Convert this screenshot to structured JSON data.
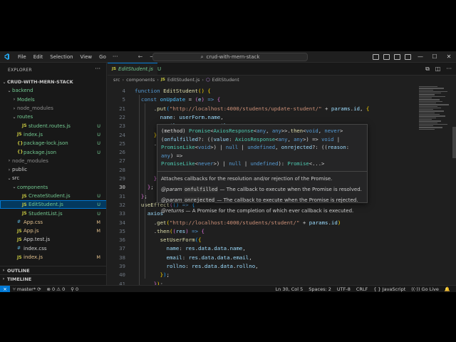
{
  "titlebar": {
    "menu": [
      "File",
      "Edit",
      "Selection",
      "View",
      "Go"
    ],
    "more": "···",
    "back": "←",
    "forward": "→",
    "search_text": "crud-with-mern-stack",
    "minimize": "—",
    "maximize": "☐",
    "close": "✕"
  },
  "sidebar": {
    "title": "EXPLORER",
    "more": "···",
    "tree": [
      {
        "label": "CRUD-WITH-MERN-STACK",
        "indent": 0,
        "chev": "⌄",
        "kind": "root"
      },
      {
        "label": "backend",
        "indent": 1,
        "chev": "⌄",
        "kind": "folder",
        "color": "green"
      },
      {
        "label": "Models",
        "indent": 2,
        "chev": "›",
        "kind": "folder",
        "color": "green"
      },
      {
        "label": "node_modules",
        "indent": 2,
        "chev": "›",
        "kind": "folder",
        "color": "grey"
      },
      {
        "label": "routes",
        "indent": 2,
        "chev": "⌄",
        "kind": "folder",
        "color": "green"
      },
      {
        "label": "student.routes.js",
        "indent": 3,
        "kind": "js",
        "color": "green",
        "badge": "U"
      },
      {
        "label": "index.js",
        "indent": 2,
        "kind": "js",
        "color": "green",
        "badge": "U"
      },
      {
        "label": "package-lock.json",
        "indent": 2,
        "kind": "json",
        "color": "green",
        "badge": "U"
      },
      {
        "label": "package.json",
        "indent": 2,
        "kind": "json",
        "color": "green",
        "badge": "U"
      },
      {
        "label": "node_modules",
        "indent": 1,
        "chev": "›",
        "kind": "folder",
        "color": "grey"
      },
      {
        "label": "public",
        "indent": 1,
        "chev": "›",
        "kind": "folder"
      },
      {
        "label": "src",
        "indent": 1,
        "chev": "⌄",
        "kind": "folder"
      },
      {
        "label": "components",
        "indent": 2,
        "chev": "⌄",
        "kind": "folder",
        "color": "green"
      },
      {
        "label": "CreateStudent.js",
        "indent": 3,
        "kind": "js",
        "color": "green",
        "badge": "U"
      },
      {
        "label": "EditStudent.js",
        "indent": 3,
        "kind": "js",
        "color": "green",
        "badge": "U",
        "selected": true
      },
      {
        "label": "StudentList.js",
        "indent": 3,
        "kind": "js",
        "color": "green",
        "badge": "U"
      },
      {
        "label": "App.css",
        "indent": 2,
        "kind": "css",
        "color": "orange",
        "badge": "M"
      },
      {
        "label": "App.js",
        "indent": 2,
        "kind": "js",
        "color": "orange",
        "badge": "M"
      },
      {
        "label": "App.test.js",
        "indent": 2,
        "kind": "js"
      },
      {
        "label": "index.css",
        "indent": 2,
        "kind": "css"
      },
      {
        "label": "index.js",
        "indent": 2,
        "kind": "js",
        "color": "orange",
        "badge": "M"
      }
    ],
    "outline": "OUTLINE",
    "timeline": "TIMELINE"
  },
  "editor": {
    "tab": {
      "icon": "JS",
      "name": "EditStudent.js",
      "status": "U"
    },
    "breadcrumb": [
      "src",
      "components",
      "EditStudent.js",
      "EditStudent"
    ],
    "lines": [
      {
        "n": "4",
        "html": "<span class='k'>function</span> <span class='f'>EditStudent</span><span class='bk1'>()</span> <span class='bk1'>{</span>"
      },
      {
        "n": "5",
        "html": "  <span class='k'>const</span> <span class='vc'>onUpdate</span> <span class='p'>=</span> <span class='bk2'>(</span><span class='v'>e</span><span class='bk2'>)</span> <span class='k'>=&gt;</span> <span class='bk2'>{</span>"
      },
      {
        "n": "21",
        "html": "      <span class='p'>.</span><span class='f'>put</span><span class='bk3'>(</span><span class='s'>\"http://localhost:4000/students/update-student/\"</span> <span class='p'>+</span> <span class='v'>params</span><span class='p'>.</span><span class='v'>id</span><span class='p'>,</span> <span class='bk1'>{</span>"
      },
      {
        "n": "22",
        "html": "        <span class='v'>name</span><span class='p'>:</span> <span class='v'>userForm</span><span class='p'>.</span><span class='v'>name</span><span class='p'>,</span>"
      },
      {
        "n": "23",
        "html": "        <span class='v'>email</span><span class='p'>:</span> <span class='v'>userForm</span><span class='p'>.</span><span class='v'>email</span><span class='p'>,</span>"
      },
      {
        "n": "24",
        "html": "      <span class='bk1'>}</span><span class='bk3'>)</span>"
      },
      {
        "n": "25",
        "html": "      <span class='p'>.</span><span class='f'>then</span><span class='bk3'>(</span><span class='bk2'>(</span><span class='v'>res</span><span class='bk2'>)</span> <span class='k'>=&gt;</span> <span class='bk2'>{</span>"
      },
      {
        "n": "26",
        "html": ""
      },
      {
        "n": "27",
        "html": ""
      },
      {
        "n": "28",
        "html": ""
      },
      {
        "n": "29",
        "html": "      <span class='bk2'>}</span><span class='bk3'>)</span><span class='p'>;</span>"
      },
      {
        "n": "30",
        "html": "    <span class='bk2'>}</span><span class='p'>;</span>",
        "active": true
      },
      {
        "n": "31",
        "html": "  <span class='bk2'>}</span><span class='p'>;</span>"
      },
      {
        "n": "32",
        "html": "  <span class='f'>useEffect</span><span class='bk2'>(</span><span class='bk3'>()</span> <span class='k'>=&gt;</span> <span class='bk3'>{</span>"
      },
      {
        "n": "33",
        "html": "    <span class='v'>axios</span>"
      },
      {
        "n": "34",
        "html": "      <span class='p'>.</span><span class='f'>get</span><span class='bk1'>(</span><span class='s'>\"http://localhost:4000/students/student/\"</span> <span class='p'>+</span> <span class='v'>params</span><span class='p'>.</span><span class='v'>id</span><span class='bk1'>)</span>"
      },
      {
        "n": "35",
        "html": "      <span class='p'>.</span><span class='f'>then</span><span class='bk1'>(</span><span class='bk2'>(</span><span class='v'>res</span><span class='bk2'>)</span> <span class='k'>=&gt;</span> <span class='bk2'>{</span>"
      },
      {
        "n": "36",
        "html": "        <span class='f'>setUserForm</span><span class='bk3'>(</span><span class='bk1'>{</span>"
      },
      {
        "n": "37",
        "html": "          <span class='v'>name</span><span class='p'>:</span> <span class='v'>res</span><span class='p'>.</span><span class='v'>data</span><span class='p'>.</span><span class='v'>data</span><span class='p'>.</span><span class='v'>name</span><span class='p'>,</span>"
      },
      {
        "n": "38",
        "html": "          <span class='v'>email</span><span class='p'>:</span> <span class='v'>res</span><span class='p'>.</span><span class='v'>data</span><span class='p'>.</span><span class='v'>data</span><span class='p'>.</span><span class='v'>email</span><span class='p'>,</span>"
      },
      {
        "n": "39",
        "html": "          <span class='v'>rollno</span><span class='p'>:</span> <span class='v'>res</span><span class='p'>.</span><span class='v'>data</span><span class='p'>.</span><span class='v'>data</span><span class='p'>.</span><span class='v'>rollno</span><span class='p'>,</span>"
      },
      {
        "n": "40",
        "html": "        <span class='bk1'>}</span><span class='bk3'>)</span><span class='p'>;</span>"
      },
      {
        "n": "41",
        "html": "      <span class='bk2'>}</span><span class='bk1'>)</span><span class='p'>;</span>"
      },
      {
        "n": "42",
        "html": "  <span class='bk3'>}</span><span class='p'>,</span> <span class='bk3'>[]</span><span class='bk2'>)</span><span class='p'>;</span>"
      },
      {
        "n": "43",
        "html": "  <span class='kc'>return</span> <span class='bk2'>(</span>"
      },
      {
        "n": "44",
        "html": "    <span class='p'>&lt;</span><span class='k'>div</span><span class='p'>&gt;</span>"
      },
      {
        "n": "45",
        "html": "      <span class='p'>&lt;</span><span class='k'>div</span> <span class='v'>className</span><span class='p'>=</span><span class='s'>\"form-wrapper\"</span><span class='p'>&gt;</span>"
      }
    ]
  },
  "hover": {
    "sig": [
      "<span class='p'>(method)</span> <span class='t'>Promise</span><span class='p'>&lt;</span><span class='t'>AxiosResponse</span><span class='p'>&lt;</span><span class='k'>any</span><span class='p'>,</span> <span class='k'>any</span><span class='p'>&gt;&gt;.</span><span class='f'>then</span><span class='p'>&lt;</span><span class='k'>void</span><span class='p'>,</span> <span class='k'>never</span><span class='p'>&gt;</span>",
      "<span class='p'>(</span><span class='v'>onfulfilled</span><span class='p'>?: ((</span><span class='v'>value</span><span class='p'>:</span> <span class='t'>AxiosResponse</span><span class='p'>&lt;</span><span class='k'>any</span><span class='p'>,</span> <span class='k'>any</span><span class='p'>&gt;) =&gt;</span> <span class='k'>void</span> <span class='p'>|</span>",
      "<span class='t'>PromiseLike</span><span class='p'>&lt;</span><span class='k'>void</span><span class='p'>&gt;) |</span> <span class='k'>null</span> <span class='p'>|</span> <span class='k'>undefined</span><span class='p'>,</span> <span class='v'>onrejected</span><span class='p'>?: ((</span><span class='v'>reason</span><span class='p'>:</span> <span class='k'>any</span><span class='p'>) =&gt;</span>",
      "<span class='t'>PromiseLike</span><span class='p'>&lt;</span><span class='k'>never</span><span class='p'>&gt;) |</span> <span class='k'>null</span> <span class='p'>|</span> <span class='k'>undefined</span><span class='p'>):</span> <span class='t'>Promise</span><span class='p'>&lt;...&gt;</span>"
    ],
    "doc": [
      "Attaches callbacks for the resolution and/or rejection of the Promise.",
      "<i>@param</i> <code>onfulfilled</code> — The callback to execute when the Promise is resolved.",
      "<i>@param</i> <code>onrejected</code> — The callback to execute when the Promise is rejected.",
      "<i>@returns</i> — A Promise for the completion of which ever callback is executed."
    ]
  },
  "statusbar": {
    "remote": "⨯",
    "branch": "master*",
    "sync": "⟳",
    "errors": "⊗ 0",
    "warnings": "⚠ 0",
    "ports": "⚲ 0",
    "position": "Ln 30, Col 5",
    "spaces": "Spaces: 2",
    "encoding": "UTF-8",
    "eol": "CRLF",
    "language": "{ } JavaScript",
    "golive": "((·)) Go Live",
    "bell": "🔔"
  }
}
